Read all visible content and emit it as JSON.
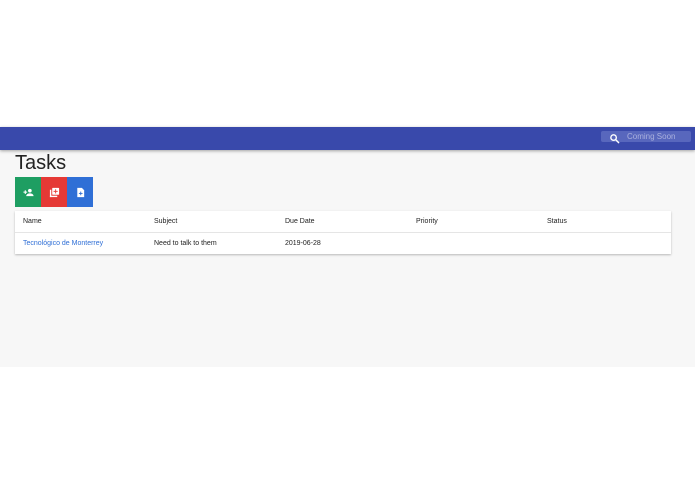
{
  "search": {
    "placeholder": "Coming Soon"
  },
  "page": {
    "title": "Tasks"
  },
  "actions": [
    {
      "icon": "add-user-icon",
      "color": "#1e9e62"
    },
    {
      "icon": "add-to-library-icon",
      "color": "#e53935"
    },
    {
      "icon": "add-document-icon",
      "color": "#2f6fd6"
    }
  ],
  "table": {
    "columns": [
      "Name",
      "Subject",
      "Due Date",
      "Priority",
      "Status"
    ],
    "rows": [
      {
        "name": "Tecnológico de Monterrey",
        "subject": "Need to talk to them",
        "due_date": "2019-06-28",
        "priority": "",
        "status": ""
      }
    ]
  },
  "colors": {
    "header": "#3949ab",
    "link": "#2f6fd6",
    "background": "#f7f7f7"
  }
}
